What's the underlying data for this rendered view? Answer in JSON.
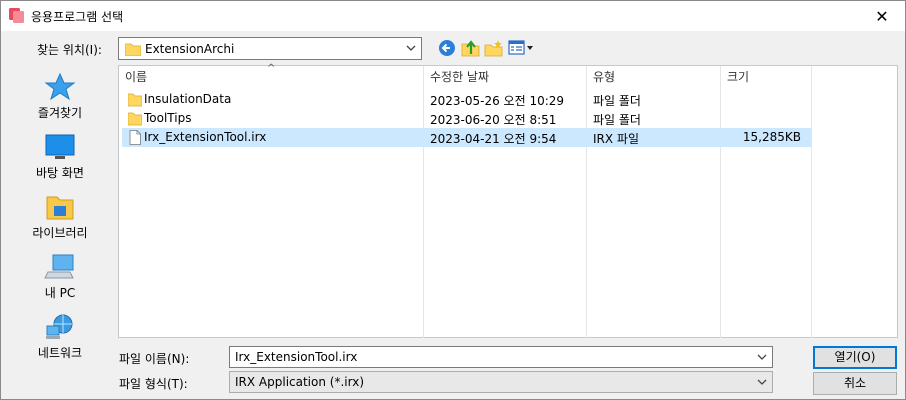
{
  "window": {
    "title": "응용프로그램 선택",
    "close_symbol": "✕"
  },
  "toolbar": {
    "lookin_label": "찾는 위치(I):",
    "lookin_value": "ExtensionArchi"
  },
  "places": [
    {
      "label": "즐겨찾기",
      "icon": "star-icon"
    },
    {
      "label": "바탕 화면",
      "icon": "desktop-icon"
    },
    {
      "label": "라이브러리",
      "icon": "library-icon"
    },
    {
      "label": "내 PC",
      "icon": "computer-icon"
    },
    {
      "label": "네트워크",
      "icon": "network-icon"
    }
  ],
  "list": {
    "columns": {
      "name": "이름",
      "date": "수정한 날짜",
      "type": "유형",
      "size": "크기"
    },
    "rows": [
      {
        "name": "InsulationData",
        "date": "2023-05-26 오전 10:29",
        "type": "파일 폴더",
        "size": "",
        "icon": "folder-icon",
        "selected": false
      },
      {
        "name": "ToolTips",
        "date": "2023-06-20 오전 8:51",
        "type": "파일 폴더",
        "size": "",
        "icon": "folder-icon",
        "selected": false
      },
      {
        "name": "Irx_ExtensionTool.irx",
        "date": "2023-04-21 오전 9:54",
        "type": "IRX 파일",
        "size": "15,285KB",
        "icon": "file-icon",
        "selected": true
      }
    ]
  },
  "footer": {
    "filename_label": "파일 이름(N):",
    "filename_value": "Irx_ExtensionTool.irx",
    "filetype_label": "파일 형식(T):",
    "filetype_value": "IRX Application (*.irx)",
    "open_label": "열기(O)",
    "cancel_label": "취소"
  },
  "colors": {
    "selection": "#cce8ff",
    "accent": "#0078d7",
    "folder": "#ffd75e"
  }
}
